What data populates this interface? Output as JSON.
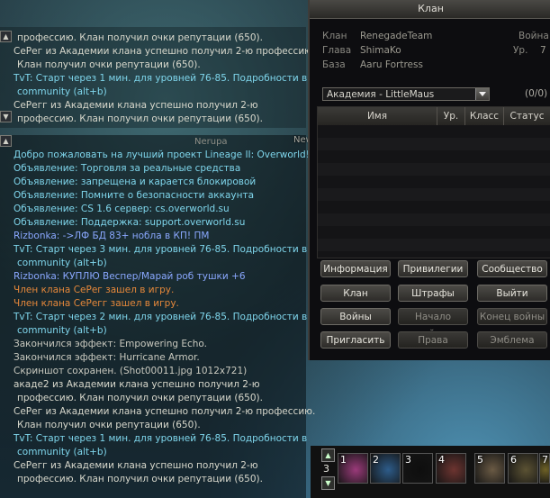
{
  "chat_top": {
    "lines": [
      {
        "text": "профессию. Клан получил очки репутации (650).",
        "color": "white",
        "cont": true
      },
      {
        "text": "СеРег из Академии клана успешно получил 2-ю профессию.",
        "color": "white",
        "cont": false
      },
      {
        "text": "Клан получил очки репутации (650).",
        "color": "white",
        "cont": true
      },
      {
        "text": "TvT: Старт через 1 мин. для уровней 76-85. Подробности в",
        "color": "cyan",
        "cont": false
      },
      {
        "text": "community (alt+b)",
        "color": "cyan",
        "cont": true
      },
      {
        "text": "СеРегг из Академии клана успешно получил 2-ю",
        "color": "white",
        "cont": false
      },
      {
        "text": "профессию. Клан получил очки репутации (650).",
        "color": "white",
        "cont": true
      }
    ]
  },
  "chat_main": {
    "tab_label": "Nerupa",
    "lines": [
      {
        "text": "Добро пожаловать на лучший проект Lineage II: Overworld!",
        "color": "cyan",
        "cont": false
      },
      {
        "text": "Объявление: Торговля за реальные средства",
        "color": "cyan",
        "cont": false
      },
      {
        "text": "Объявление: запрещена и карается блокировой",
        "color": "cyan",
        "cont": false
      },
      {
        "text": "Объявление: Помните о безопасности аккаунта",
        "color": "cyan",
        "cont": false
      },
      {
        "text": "Объявление: CS 1.6 сервер: cs.overworld.su",
        "color": "cyan",
        "cont": false
      },
      {
        "text": "Объявление: Поддержка: support.overworld.su",
        "color": "cyan",
        "cont": false
      },
      {
        "text": "Rizbonka:  ->ЛФ БД 83+ нобла в КП! ПМ",
        "color": "blue",
        "cont": false
      },
      {
        "text": "TvT: Старт через 3 мин. для уровней 76-85. Подробности в",
        "color": "cyan",
        "cont": false
      },
      {
        "text": "community (alt+b)",
        "color": "cyan",
        "cont": true
      },
      {
        "text": "Rizbonka:  КУПЛЮ Веспер/Марай роб тушки +6",
        "color": "blue",
        "cont": false
      },
      {
        "text": "Член клана СеРег зашел в игру.",
        "color": "orange",
        "cont": false
      },
      {
        "text": "Член клана СеРегг зашел в игру.",
        "color": "orange",
        "cont": false
      },
      {
        "text": "TvT: Старт через 2 мин. для уровней 76-85. Подробности в",
        "color": "cyan",
        "cont": false
      },
      {
        "text": "community (alt+b)",
        "color": "cyan",
        "cont": true
      },
      {
        "text": "Закончился эффект: Empowering Echo.",
        "color": "gray",
        "cont": false
      },
      {
        "text": "Закончился эффект: Hurricane Armor.",
        "color": "gray",
        "cont": false
      },
      {
        "text": "Скриншот сохранен. (Shot00011.jpg 1012x721)",
        "color": "gray",
        "cont": false
      },
      {
        "text": "акаде2 из Академии клана успешно получил 2-ю",
        "color": "white",
        "cont": false
      },
      {
        "text": "профессию. Клан получил очки репутации (650).",
        "color": "white",
        "cont": true
      },
      {
        "text": "СеРег из Академии клана успешно получил 2-ю профессию.",
        "color": "white",
        "cont": false
      },
      {
        "text": "Клан получил очки репутации (650).",
        "color": "white",
        "cont": true
      },
      {
        "text": "TvT: Старт через 1 мин. для уровней 76-85. Подробности в",
        "color": "cyan",
        "cont": false
      },
      {
        "text": "community (alt+b)",
        "color": "cyan",
        "cont": true
      },
      {
        "text": "СеРегг из Академии клана успешно получил 2-ю",
        "color": "white",
        "cont": false
      },
      {
        "text": "профессию. Клан получил очки репутации (650).",
        "color": "white",
        "cont": true
      }
    ]
  },
  "overlay": {
    "newbie_helper": "Newbie Helper"
  },
  "clan": {
    "title": "Клан",
    "clan_label": "Клан",
    "clan_value": "RenegadeTeam",
    "leader_label": "Глава",
    "leader_value": "ShimaKo",
    "base_label": "База",
    "base_value": "Aaru Fortress",
    "war_label": "Война",
    "level_label": "Ур.",
    "level_value": "7",
    "unit_selected": "Академия - LittleMaus",
    "member_count": "(0/0)",
    "columns": [
      "Имя",
      "Ур.",
      "Класс",
      "Статус"
    ],
    "buttons": [
      {
        "label": "Информация",
        "enabled": true
      },
      {
        "label": "Привилегии",
        "enabled": true
      },
      {
        "label": "Сообщество",
        "enabled": true
      },
      {
        "label": "Клан",
        "enabled": true
      },
      {
        "label": "Штрафы",
        "enabled": true
      },
      {
        "label": "Выйти",
        "enabled": true
      },
      {
        "label": "Войны",
        "enabled": true
      },
      {
        "label": "Начало войны",
        "enabled": false
      },
      {
        "label": "Конец войны",
        "enabled": false
      },
      {
        "label": "Пригласить",
        "enabled": true
      },
      {
        "label": "Права",
        "enabled": false
      },
      {
        "label": "Эмблема",
        "enabled": false
      }
    ]
  },
  "hotbar": {
    "page": "3",
    "slots": [
      {
        "key": "1",
        "icon": "pink-skill-icon",
        "color": "#9a3a7a"
      },
      {
        "key": "2",
        "icon": "blue-skill-icon",
        "color": "#2d5c8a"
      },
      {
        "key": "3",
        "icon": "empty-slot",
        "color": "#0e0e0e"
      },
      {
        "key": "4",
        "icon": "red-skill-icon",
        "color": "#6d3430"
      },
      {
        "key": "5",
        "icon": "tan-skill-icon",
        "color": "#6a5a44"
      },
      {
        "key": "6",
        "icon": "arrow-skill-icon",
        "color": "#5b5233"
      },
      {
        "key": "7",
        "icon": "gold-skill-icon",
        "color": "#6e6126"
      }
    ]
  },
  "colors": {
    "white": "#d8d8cc",
    "cyan": "#7fd6ec",
    "blue": "#8aa8ff",
    "orange": "#e6883a",
    "gray": "#c9c9bf"
  }
}
